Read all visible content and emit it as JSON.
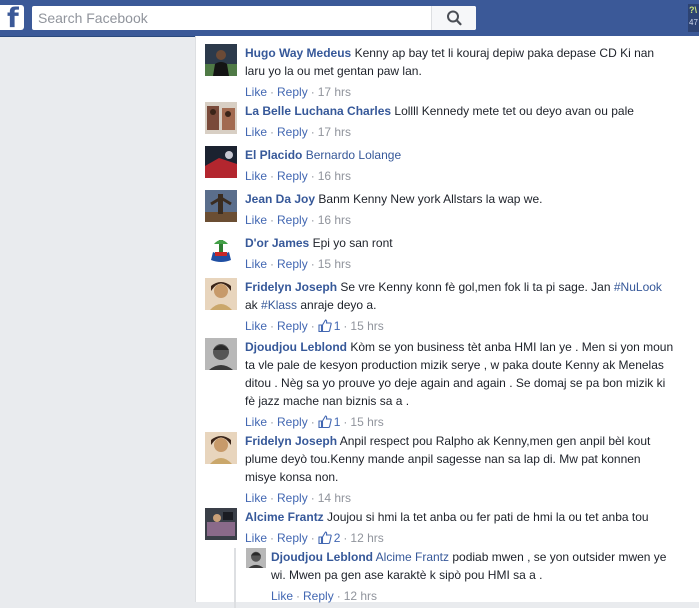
{
  "header": {
    "logo_letter": "f",
    "search_placeholder": "Search Facebook",
    "corner_line1": "?\\",
    "corner_line2": "47"
  },
  "actions": {
    "like": "Like",
    "reply": "Reply"
  },
  "comments": [
    {
      "name": "Hugo Way Medeus",
      "text": "Kenny ap bay tet li kouraj depiw paka depase CD Ki nan laru yo la ou met gentan paw lan.",
      "time": "17 hrs",
      "avatar_colors": [
        "#2c3a4b",
        "#4f7a46"
      ]
    },
    {
      "name": "La Belle Luchana Charles",
      "text": "Lollll Kennedy mete tet ou deyo avan ou pale",
      "time": "17 hrs",
      "avatar_colors": [
        "#d8cfc4",
        "#7a4a3a"
      ]
    },
    {
      "name": "El Placido",
      "tag": "Bernardo Lolange",
      "text": "",
      "time": "16 hrs",
      "avatar_colors": [
        "#1b2230",
        "#b3262e"
      ]
    },
    {
      "name": "Jean Da Joy",
      "text": "Banm Kenny New york Allstars la wap we.",
      "time": "16 hrs",
      "avatar_colors": [
        "#5a6e8c",
        "#6b4e33"
      ]
    },
    {
      "name": "D'or James",
      "text": "Epi yo san ront",
      "time": "15 hrs",
      "avatar_colors": [
        "#ffffff",
        "#1f4fa3"
      ]
    },
    {
      "name": "Fridelyn Joseph",
      "text_parts": [
        "Se vre Kenny konn fè gol,men fok li ta pi sage. Jan ",
        "#NuLook",
        " ak ",
        "#Klass",
        " anraje deyo a."
      ],
      "time": "15 hrs",
      "likes": "1",
      "avatar_colors": [
        "#c79a6a",
        "#3a2418"
      ]
    },
    {
      "name": "Djoudjou Leblond",
      "text": "Kòm se yon business tèt anba HMI lan ye . Men si yon moun ta vle pale de kesyon production mizik serye , w paka doute Kenny ak Menelas ditou . Nèg sa yo prouve yo deje again and again . Se domaj se pa bon mizik ki fè jazz mache nan biznis sa a .",
      "time": "15 hrs",
      "likes": "1",
      "avatar_colors": [
        "#b8b8b8",
        "#2a2a2a"
      ]
    },
    {
      "name": "Fridelyn Joseph",
      "text": "Anpil respect pou Ralpho ak Kenny,men gen anpil bèl kout plume deyò tou.Kenny mande anpil sagesse nan sa lap di. Mw pat konnen misye konsa non.",
      "time": "14 hrs",
      "avatar_colors": [
        "#c79a6a",
        "#3a2418"
      ]
    },
    {
      "name": "Alcime Frantz",
      "text": "Joujou si hmi la tet anba ou fer pati de hmi la ou tet anba tou",
      "time": "12 hrs",
      "likes": "2",
      "avatar_colors": [
        "#3a3f48",
        "#8a6a8a"
      ]
    }
  ],
  "reply": {
    "name": "Djoudjou Leblond",
    "tag": "Alcime Frantz",
    "text": "podiab mwen , se yon outsider mwen ye wi. Mwen pa gen ase karaktè k sipò pou HMI sa a .",
    "time": "12 hrs",
    "avatar_colors": [
      "#b8b8b8",
      "#2a2a2a"
    ]
  }
}
